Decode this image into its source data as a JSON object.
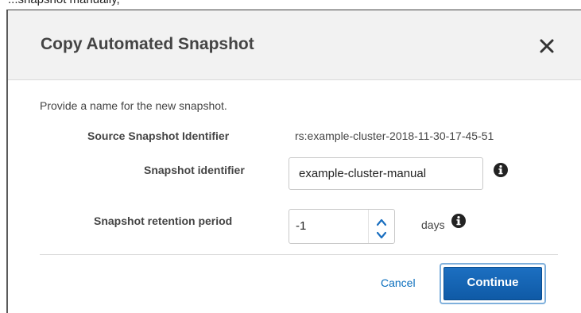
{
  "background": {
    "partial_text": "...snapshot manually,"
  },
  "dialog": {
    "title": "Copy Automated Snapshot",
    "close_icon": "close-icon",
    "intro": "Provide a name for the new snapshot.",
    "source_snapshot": {
      "label": "Source Snapshot Identifier",
      "value": "rs:example-cluster-2018-11-30-17-45-51"
    },
    "snapshot_identifier": {
      "label": "Snapshot identifier",
      "value": "example-cluster-manual",
      "info_icon": "info-icon"
    },
    "retention_period": {
      "label": "Snapshot retention period",
      "value": "-1",
      "unit": "days",
      "info_icon": "info-icon"
    },
    "buttons": {
      "cancel": "Cancel",
      "continue": "Continue"
    },
    "colors": {
      "header_bg": "#f2f2f2",
      "primary": "#1565b8",
      "link": "#0a6ebd",
      "text": "#444444"
    }
  }
}
